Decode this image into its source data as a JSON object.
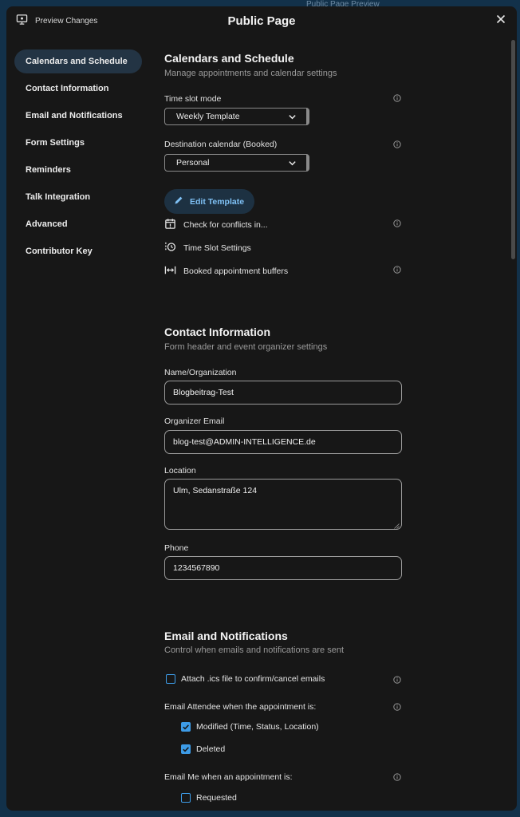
{
  "background": {
    "title": "Public Page Preview"
  },
  "header": {
    "preview_label": "Preview Changes",
    "title": "Public Page"
  },
  "nav": {
    "items": [
      "Calendars and Schedule",
      "Contact Information",
      "Email and Notifications",
      "Form Settings",
      "Reminders",
      "Talk Integration",
      "Advanced",
      "Contributor Key"
    ]
  },
  "calendars": {
    "title": "Calendars and Schedule",
    "subtitle": "Manage appointments and calendar settings",
    "time_slot_label": "Time slot mode",
    "time_slot_value": "Weekly Template",
    "destination_label": "Destination calendar (Booked)",
    "destination_value": "Personal",
    "edit_template": "Edit Template",
    "conflicts": "Check for conflicts in...",
    "time_slot_settings": "Time Slot Settings",
    "buffers": "Booked appointment buffers"
  },
  "contact": {
    "title": "Contact Information",
    "subtitle": "Form header and event organizer settings",
    "name_label": "Name/Organization",
    "name_value": "Blogbeitrag-Test",
    "email_label": "Organizer Email",
    "email_value": "blog-test@ADMIN-INTELLIGENCE.de",
    "location_label": "Location",
    "location_value": "Ulm, Sedanstraße 124",
    "phone_label": "Phone",
    "phone_value": "1234567890"
  },
  "email": {
    "title": "Email and Notifications",
    "subtitle": "Control when emails and notifications are sent",
    "attach_ics": "Attach .ics file to confirm/cancel emails",
    "attendee_label": "Email Attendee when the appointment is:",
    "modified": "Modified (Time, Status, Location)",
    "deleted": "Deleted",
    "me_label": "Email Me when an appointment is:",
    "requested": "Requested"
  },
  "colors": {
    "accent": "#3d9be6",
    "link": "#7fc1f5",
    "background": "#171717"
  }
}
